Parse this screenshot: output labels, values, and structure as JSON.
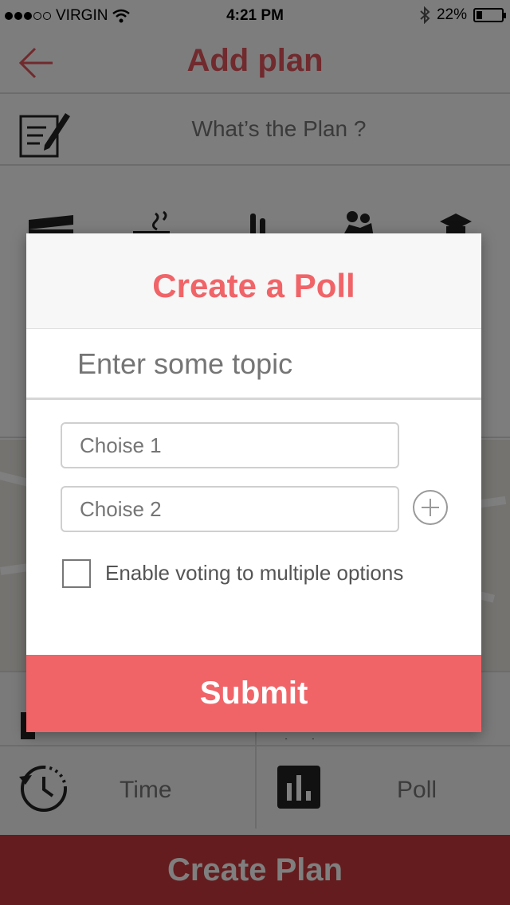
{
  "status_bar": {
    "carrier": "VIRGIN",
    "time": "4:21 PM",
    "battery": "22%",
    "battery_level": 0.22
  },
  "header": {
    "title": "Add plan",
    "back_icon": "arrow-left-icon"
  },
  "plan": {
    "placeholder": "What’s the Plan ?",
    "icon": "notepad-pencil-icon"
  },
  "categories": [
    "clapperboard-icon",
    "coffee-icon",
    "drinks-icon",
    "dancing-icon",
    "graduation-cap-icon"
  ],
  "options": {
    "time_label": "Time",
    "poll_label": "Poll",
    "time_icon": "clock-icon",
    "poll_icon": "bar-chart-icon"
  },
  "create_button": "Create Plan",
  "poll_modal": {
    "title": "Create a Poll",
    "topic_placeholder": "Enter some topic",
    "choice_1_placeholder": "Choise 1",
    "choice_2_placeholder": "Choise 2",
    "multiple_label": "Enable voting to multiple options",
    "submit_label": "Submit"
  },
  "colors": {
    "accent": "#f06468",
    "header_title": "#e2555a",
    "create_button": "#c9393c"
  }
}
